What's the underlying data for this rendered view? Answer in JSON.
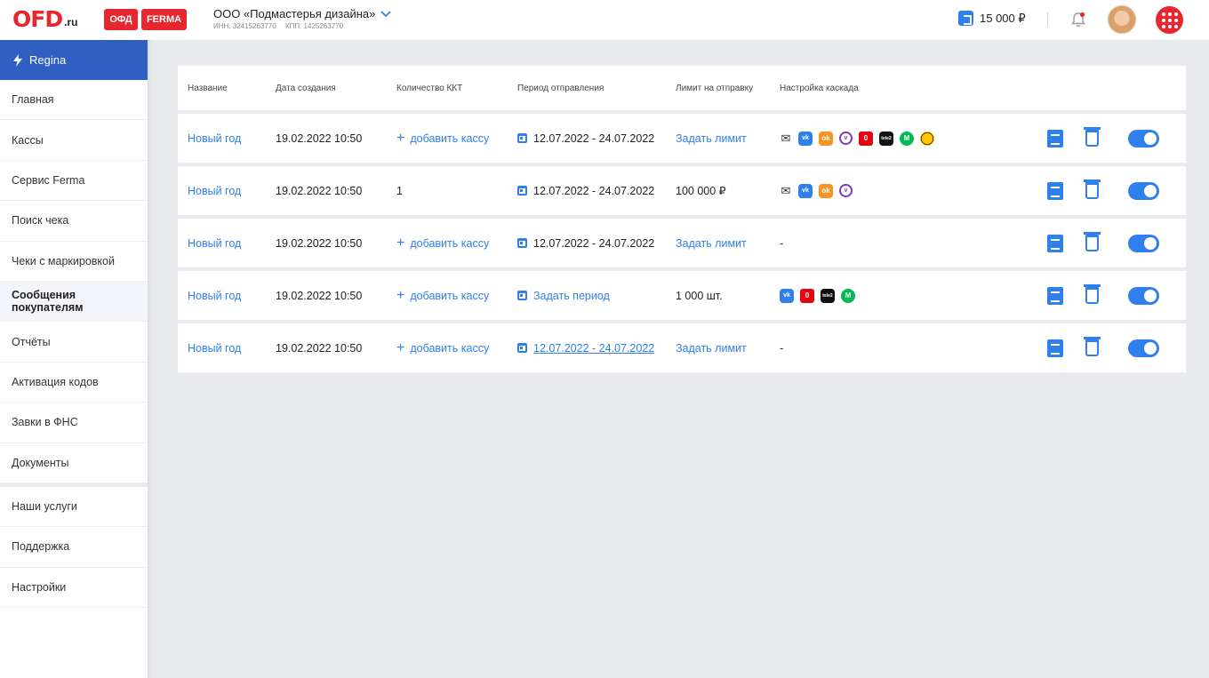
{
  "header": {
    "logo_main": "OFD",
    "logo_suffix": ".ru",
    "badge_ofd": "ОФД",
    "badge_ferma": "FERMA",
    "company_name": "ООО «Подмастерья дизайна»",
    "inn": "ИНН: 32415263770",
    "kpp": "КПП: 1425263770",
    "balance": "15 000 ₽"
  },
  "sidebar": {
    "user": "Regina",
    "items": [
      {
        "label": "Главная"
      },
      {
        "label": "Кассы"
      },
      {
        "label": "Сервис Ferma"
      },
      {
        "label": "Поиск чека"
      },
      {
        "label": "Чеки с маркировкой"
      },
      {
        "label": "Сообщения покупателям"
      },
      {
        "label": "Отчёты"
      },
      {
        "label": "Активация кодов"
      },
      {
        "label": "Завки в ФНС"
      },
      {
        "label": "Документы"
      }
    ],
    "bottom_items": [
      {
        "label": "Наши услуги"
      },
      {
        "label": "Поддержка"
      },
      {
        "label": "Настройки"
      }
    ]
  },
  "table": {
    "columns": [
      "Название",
      "Дата создания",
      "Количество ККТ",
      "Период отправления",
      "Лимит на отправку",
      "Настройка каскада"
    ],
    "rows": [
      {
        "name": "Новый год",
        "date": "19.02.2022 10:50",
        "kkt": "добавить кассу",
        "period": "12.07.2022 - 24.07.2022",
        "limit": "Задать лимит",
        "cascade": "",
        "toggle_on": true
      },
      {
        "name": "Новый год",
        "date": "19.02.2022 10:50",
        "kkt": "1",
        "period": "12.07.2022 - 24.07.2022",
        "limit": "100 000 ₽",
        "cascade": "",
        "toggle_on": true
      },
      {
        "name": "Новый год",
        "date": "19.02.2022 10:50",
        "kkt": "добавить кассу",
        "period": "12.07.2022 - 24.07.2022",
        "limit": "Задать лимит",
        "cascade": "-",
        "toggle_on": true
      },
      {
        "name": "Новый год",
        "date": "19.02.2022 10:50",
        "kkt": "добавить кассу",
        "period": "Задать период",
        "limit": "1 000 шт.",
        "cascade": "",
        "toggle_on": true
      },
      {
        "name": "Новый год",
        "date": "19.02.2022 10:50",
        "kkt": "добавить кассу",
        "period": "12.07.2022 - 24.07.2022",
        "limit": "Задать лимит",
        "cascade": "-",
        "toggle_on": true
      }
    ],
    "icons": {
      "mail": "✉",
      "vk": "vk",
      "ok": "ok",
      "viber": "v",
      "mts": "0",
      "tele2": "tele2",
      "megafon": "M"
    }
  },
  "colors": {
    "brand_red": "#e8262d",
    "accent_blue": "#2f80ed",
    "sidebar_active": "#2f5fc3"
  }
}
